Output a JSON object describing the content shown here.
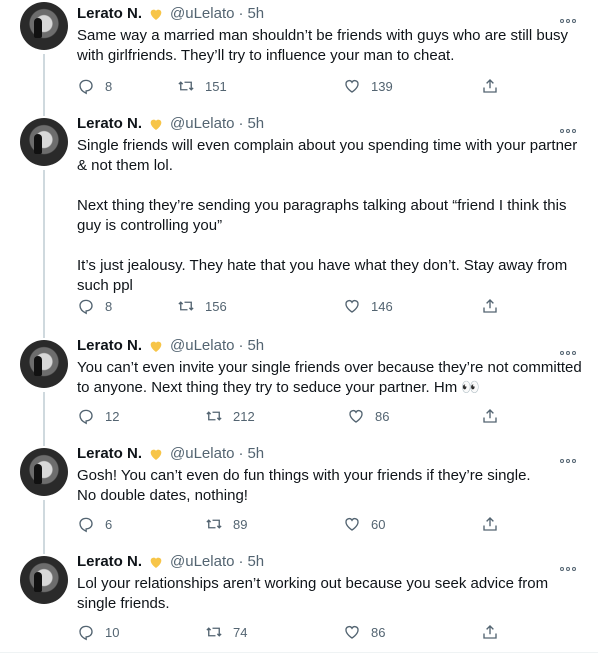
{
  "tweets": [
    {
      "name": "Lerato N.",
      "handle": "@uLelato",
      "dot": "·",
      "time": "5h",
      "text": [
        "Same way a married man shouldn’t be friends with guys who are still busy with girlfriends. They’ll try to influence your man to cheat."
      ],
      "replies": "8",
      "retweets": "151",
      "likes": "139"
    },
    {
      "name": "Lerato N.",
      "handle": "@uLelato",
      "dot": "·",
      "time": "5h",
      "text": [
        "Single friends will even complain about you spending time with your partner & not them lol.",
        "Next thing they’re sending you paragraphs talking about “friend I think this guy is controlling you”",
        "It’s just jealousy. They hate that you have what they don’t. Stay away from such ppl"
      ],
      "replies": "8",
      "retweets": "156",
      "likes": "146"
    },
    {
      "name": "Lerato N.",
      "handle": "@uLelato",
      "dot": "·",
      "time": "5h",
      "text": [
        "You can’t even invite your single friends over because they’re not committed to anyone. Next thing they try to seduce your partner. Hm 👀"
      ],
      "replies": "12",
      "retweets": "212",
      "likes": "86"
    },
    {
      "name": "Lerato N.",
      "handle": "@uLelato",
      "dot": "·",
      "time": "5h",
      "text": [
        "Gosh! You can’t even do fun things with your friends if they’re single.",
        "No double dates, nothing!"
      ],
      "replies": "6",
      "retweets": "89",
      "likes": "60"
    },
    {
      "name": "Lerato N.",
      "handle": "@uLelato",
      "dot": "·",
      "time": "5h",
      "text": [
        "Lol your relationships aren’t working out because you seek advice from single friends."
      ],
      "replies": "10",
      "retweets": "74",
      "likes": "86"
    }
  ],
  "icons": {
    "verified_emoji": "yellow-heart-icon",
    "more": "more-dots-icon",
    "reply": "reply-icon",
    "retweet": "retweet-icon",
    "like": "like-icon",
    "share": "share-icon"
  },
  "colors": {
    "text": "#0f1419",
    "muted": "#536471",
    "heart": "#f7c548",
    "divider": "#eff3f4"
  }
}
